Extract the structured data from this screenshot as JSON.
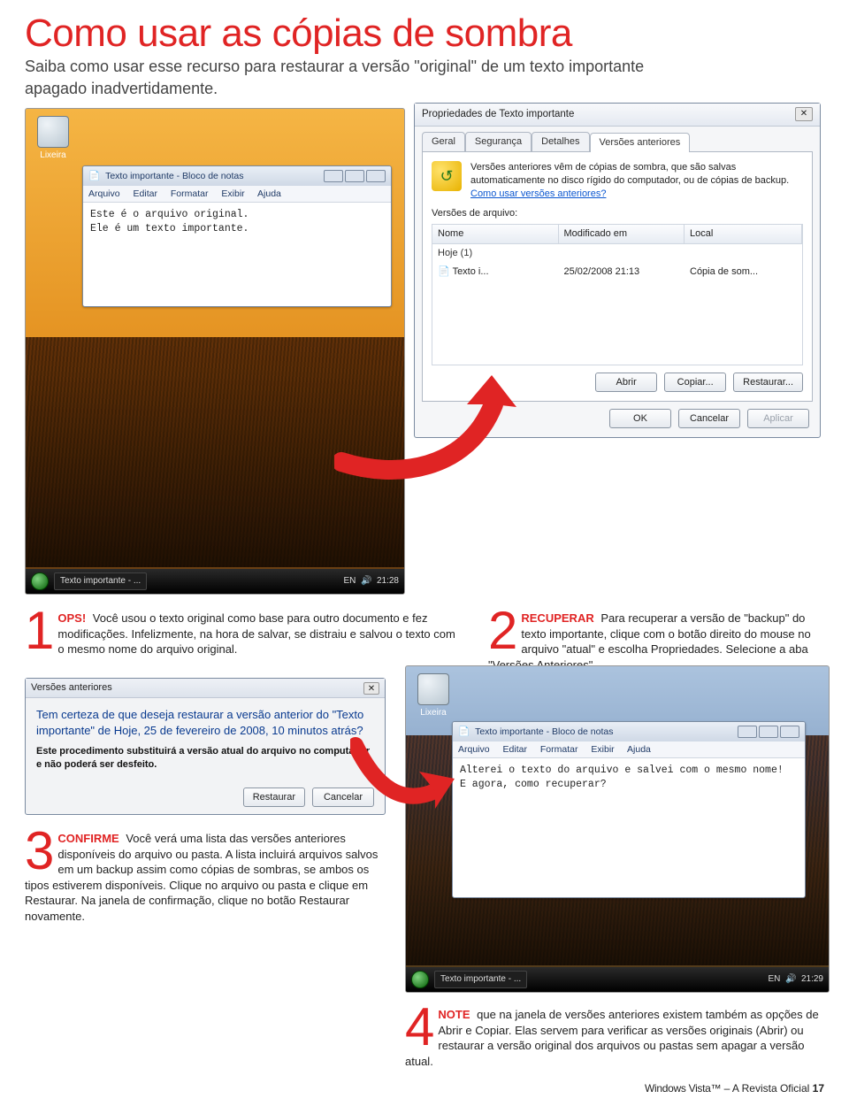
{
  "headline": "Como usar as cópias de sombra",
  "subhead": "Saiba como usar esse recurso para restaurar a versão \"original\" de um texto importante apagado inadvertidamente.",
  "recycle_label": "Lixeira",
  "notepad1": {
    "title": "Texto importante - Bloco de notas",
    "menu": {
      "file": "Arquivo",
      "edit": "Editar",
      "format": "Formatar",
      "view": "Exibir",
      "help": "Ajuda"
    },
    "line1": "Este é o arquivo original.",
    "line2": "Ele é um texto importante."
  },
  "taskbar1": {
    "item": "Texto importante - ...",
    "lang": "EN",
    "time": "21:28"
  },
  "prop": {
    "title": "Propriedades de Texto importante",
    "tabs": {
      "geral": "Geral",
      "seg": "Segurança",
      "det": "Detalhes",
      "ver": "Versões anteriores"
    },
    "desc": "Versões anteriores vêm de cópias de sombra, que são salvas automaticamente no disco rígido do computador, ou de cópias de backup. ",
    "link": "Como usar versões anteriores?",
    "list_label": "Versões de arquivo:",
    "headers": {
      "name": "Nome",
      "mod": "Modificado em",
      "local": "Local"
    },
    "group": "Hoje (1)",
    "row": {
      "name": "Texto i...",
      "mod": "25/02/2008 21:13",
      "local": "Cópia de som..."
    },
    "btns": {
      "abrir": "Abrir",
      "copiar": "Copiar...",
      "rest": "Restaurar..."
    },
    "dlgbtns": {
      "ok": "OK",
      "canc": "Cancelar",
      "aplicar": "Aplicar"
    }
  },
  "step1": {
    "lead": "OPS!",
    "body": " Você usou o texto original como base para outro documento e fez modificações. Infelizmente, na hora de salvar, se distraiu e salvou o texto com o mesmo nome do arquivo original."
  },
  "step2": {
    "lead": "RECUPERAR",
    "body": " Para recuperar a versão de \"backup\" do texto importante, clique com o botão direito do mouse no arquivo \"atual\" e escolha Propriedades. Selecione a aba \"Versões Anteriores\"."
  },
  "confirm": {
    "title": "Versões anteriores",
    "question": "Tem certeza de que deseja restaurar a versão anterior do \"Texto importante\" de Hoje, 25 de fevereiro de 2008, 10 minutos atrás?",
    "warn": "Este procedimento substituirá a versão atual do arquivo no computador e não poderá ser desfeito.",
    "btns": {
      "rest": "Restaurar",
      "canc": "Cancelar"
    }
  },
  "step3": {
    "lead": "CONFIRME",
    "body": " Você verá uma lista das versões anteriores disponíveis do arquivo ou pasta. A lista incluirá arquivos salvos em um backup assim como cópias de sombras, se ambos os tipos estiverem disponíveis. Clique no arquivo ou pasta e clique em Restaurar. Na janela de confirmação, clique no botão Restaurar novamente."
  },
  "notepad2": {
    "title": "Texto importante - Bloco de notas",
    "menu": {
      "file": "Arquivo",
      "edit": "Editar",
      "format": "Formatar",
      "view": "Exibir",
      "help": "Ajuda"
    },
    "line1": "Alterei o texto do arquivo e salvei com o mesmo nome!",
    "line2": "E agora, como recuperar?"
  },
  "taskbar2": {
    "item": "Texto importante - ...",
    "lang": "EN",
    "time": "21:29"
  },
  "step4": {
    "lead": "NOTE",
    "body": " que na janela de versões anteriores existem também as opções de Abrir e Copiar. Elas servem para verificar as versões originais (Abrir) ou restaurar a versão original dos arquivos ou pastas sem apagar a versão atual."
  },
  "footer": {
    "brand": "Windows Vista™",
    "tag": " – A Revista Oficial ",
    "page": "17"
  }
}
